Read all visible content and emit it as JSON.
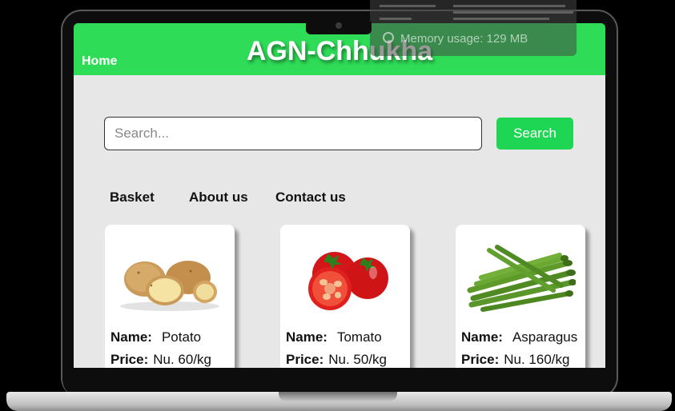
{
  "header": {
    "home_label": "Home",
    "title": "AGN-Chhukha",
    "color": "#2edc57"
  },
  "search": {
    "placeholder": "Search...",
    "button_label": "Search",
    "button_color": "#1fd654"
  },
  "nav": {
    "items": [
      "Basket",
      "About us",
      "Contact us"
    ]
  },
  "products": [
    {
      "name_key": "Name:",
      "name": "Potato",
      "price_key": "Price:",
      "price": "Nu. 60/kg",
      "image": "potato-image"
    },
    {
      "name_key": "Name:",
      "name": "Tomato",
      "price_key": "Price:",
      "price": "Nu. 50/kg",
      "image": "tomato-image"
    },
    {
      "name_key": "Name:",
      "name": "Asparagus",
      "price_key": "Price:",
      "price": "Nu. 160/kg",
      "image": "asparagus-image"
    }
  ],
  "overlay": {
    "memory_text": "Memory usage: 129 MB",
    "icon": "memory-icon"
  }
}
